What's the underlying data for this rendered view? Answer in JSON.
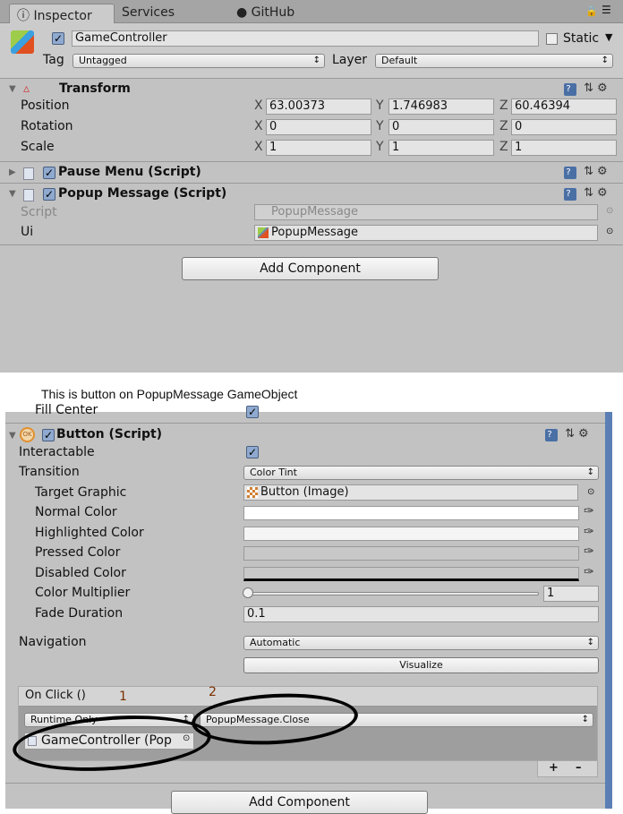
{
  "tabs": [
    {
      "label": "Inspector",
      "icon": "info-icon"
    },
    {
      "label": "Services"
    },
    {
      "label": "GitHub",
      "icon": "github-icon"
    }
  ],
  "object": {
    "name": "GameController",
    "active": true,
    "static_label": "Static",
    "tag_label": "Tag",
    "tag": "Untagged",
    "layer_label": "Layer",
    "layer": "Default"
  },
  "transform": {
    "title": "Transform",
    "rows": [
      {
        "label": "Position",
        "x": "63.00373",
        "y": "1.746983",
        "z": "60.46394"
      },
      {
        "label": "Rotation",
        "x": "0",
        "y": "0",
        "z": "0"
      },
      {
        "label": "Scale",
        "x": "1",
        "y": "1",
        "z": "1"
      }
    ],
    "axes": [
      "X",
      "Y",
      "Z"
    ]
  },
  "pause_menu": {
    "title": "Pause Menu (Script)"
  },
  "popup_message": {
    "title": "Popup Message (Script)",
    "script_label": "Script",
    "script_value": "PopupMessage",
    "ui_label": "Ui",
    "ui_value": "PopupMessage"
  },
  "add_component": "Add Component",
  "caption": "This is button on PopupMessage GameObject",
  "button_script": {
    "title": "Button (Script)",
    "partial_row": "Fill Center",
    "interactable_label": "Interactable",
    "transition_label": "Transition",
    "transition": "Color Tint",
    "target_graphic_label": "Target Graphic",
    "target_graphic": "Button (Image)",
    "normal_label": "Normal Color",
    "highlighted_label": "Highlighted Color",
    "pressed_label": "Pressed Color",
    "disabled_label": "Disabled Color",
    "multiplier_label": "Color Multiplier",
    "multiplier": "1",
    "multiplier_fraction": 0,
    "fade_label": "Fade Duration",
    "fade": "0.1",
    "navigation_label": "Navigation",
    "navigation": "Automatic",
    "visualize": "Visualize",
    "colors": {
      "normal": "#ffffff",
      "highlighted": "#f5f5f5",
      "pressed": "#c8c8c8",
      "disabled": "#c8c8c8"
    }
  },
  "on_click": {
    "title": "On Click ()",
    "runtime": "Runtime Only",
    "function": "PopupMessage.Close",
    "target": "GameController (Pop",
    "plus": "+",
    "minus": "–"
  },
  "annotations": [
    "1",
    "2"
  ]
}
